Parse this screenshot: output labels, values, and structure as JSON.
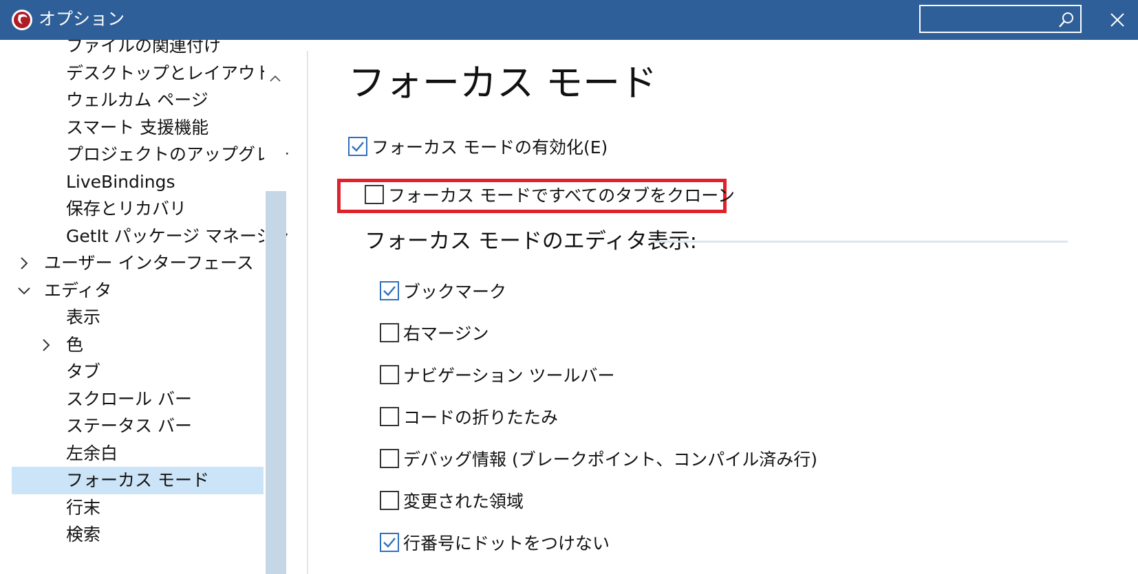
{
  "window": {
    "title": "オプション",
    "search": {
      "value": "",
      "placeholder": ""
    }
  },
  "tree": {
    "items": [
      {
        "label": "ファイルの関連付け"
      },
      {
        "label": "デスクトップとレイアウト"
      },
      {
        "label": "ウェルカム ページ"
      },
      {
        "label": "スマート 支援機能"
      },
      {
        "label": "プロジェクトのアップグレード"
      },
      {
        "label": "LiveBindings"
      },
      {
        "label": "保存とリカバリ"
      },
      {
        "label": "GetIt パッケージ マネージャ"
      },
      {
        "label": "ユーザー インターフェース",
        "chevron": "chevron-right-icon"
      },
      {
        "label": "エディタ",
        "chevron": "chevron-down-icon"
      },
      {
        "label": "表示"
      },
      {
        "label": "色",
        "chevron": "chevron-right-icon"
      },
      {
        "label": "タブ"
      },
      {
        "label": "スクロール バー"
      },
      {
        "label": "ステータス バー"
      },
      {
        "label": "左余白"
      },
      {
        "label": "フォーカス モード",
        "selected": true
      },
      {
        "label": "行末"
      },
      {
        "label": "検索"
      }
    ]
  },
  "content": {
    "title": "フォーカス モード",
    "enable_focus_mode": {
      "label": "フォーカス モードの有効化(E)",
      "checked": true
    },
    "clone_all_tabs": {
      "label": "フォーカス モードですべてのタブをクローン",
      "checked": false
    },
    "group_header": "フォーカス モードのエディタ表示:",
    "options": [
      {
        "label": "ブックマーク",
        "checked": true
      },
      {
        "label": "右マージン",
        "checked": false
      },
      {
        "label": "ナビゲーション ツールバー",
        "checked": false
      },
      {
        "label": "コードの折りたたみ",
        "checked": false
      },
      {
        "label": "デバッグ情報 (ブレークポイント、コンパイル済み行)",
        "checked": false
      },
      {
        "label": "変更された領域",
        "checked": false
      },
      {
        "label": "行番号にドットをつけない",
        "checked": true
      }
    ]
  },
  "colors": {
    "titlebar": "#2e5f98",
    "selection": "#cce4f7",
    "checkbox_accent": "#2e6fbf",
    "highlight": "#e0202a"
  }
}
